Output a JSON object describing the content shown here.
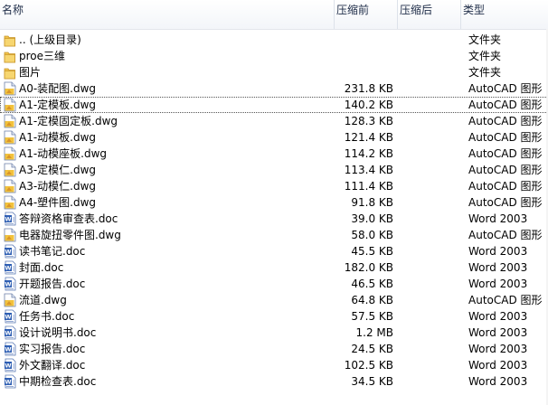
{
  "columns": {
    "name": "名称",
    "size_before": "压缩前",
    "size_after": "压缩后",
    "type": "类型"
  },
  "files": [
    {
      "name": ".. (上级目录)",
      "size": "",
      "type": "文件夹",
      "icon": "folder-icon"
    },
    {
      "name": "proe三维",
      "size": "",
      "type": "文件夹",
      "icon": "folder-icon"
    },
    {
      "name": "图片",
      "size": "",
      "type": "文件夹",
      "icon": "folder-icon"
    },
    {
      "name": "A0-装配图.dwg",
      "size": "231.8 KB",
      "type": "AutoCAD 图形",
      "icon": "dwg-file-icon"
    },
    {
      "name": "A1-定模板.dwg",
      "size": "140.2 KB",
      "type": "AutoCAD 图形",
      "icon": "dwg-file-icon",
      "focused": true
    },
    {
      "name": "A1-定模固定板.dwg",
      "size": "128.3 KB",
      "type": "AutoCAD 图形",
      "icon": "dwg-file-icon"
    },
    {
      "name": "A1-动模板.dwg",
      "size": "121.4 KB",
      "type": "AutoCAD 图形",
      "icon": "dwg-file-icon"
    },
    {
      "name": "A1-动模座板.dwg",
      "size": "114.2 KB",
      "type": "AutoCAD 图形",
      "icon": "dwg-file-icon"
    },
    {
      "name": "A3-定模仁.dwg",
      "size": "113.4 KB",
      "type": "AutoCAD 图形",
      "icon": "dwg-file-icon"
    },
    {
      "name": "A3-动模仁.dwg",
      "size": "111.4 KB",
      "type": "AutoCAD 图形",
      "icon": "dwg-file-icon"
    },
    {
      "name": "A4-塑件图.dwg",
      "size": "91.8 KB",
      "type": "AutoCAD 图形",
      "icon": "dwg-file-icon"
    },
    {
      "name": "答辩资格审查表.doc",
      "size": "39.0 KB",
      "type": "Word 2003",
      "icon": "word-doc-icon"
    },
    {
      "name": "电器旋扭零件图.dwg",
      "size": "58.0 KB",
      "type": "AutoCAD 图形",
      "icon": "dwg-file-icon"
    },
    {
      "name": "读书笔记.doc",
      "size": "45.5 KB",
      "type": "Word 2003",
      "icon": "word-doc-icon"
    },
    {
      "name": "封面.doc",
      "size": "182.0 KB",
      "type": "Word 2003",
      "icon": "word-doc-icon"
    },
    {
      "name": "开题报告.doc",
      "size": "46.5 KB",
      "type": "Word 2003",
      "icon": "word-doc-icon"
    },
    {
      "name": "流道.dwg",
      "size": "64.8 KB",
      "type": "AutoCAD 图形",
      "icon": "dwg-file-icon"
    },
    {
      "name": "任务书.doc",
      "size": "57.5 KB",
      "type": "Word 2003",
      "icon": "word-doc-icon"
    },
    {
      "name": "设计说明书.doc",
      "size": "1.2 MB",
      "type": "Word 2003",
      "icon": "word-doc-icon"
    },
    {
      "name": "实习报告.doc",
      "size": "24.5 KB",
      "type": "Word 2003",
      "icon": "word-doc-icon"
    },
    {
      "name": "外文翻译.doc",
      "size": "102.5 KB",
      "type": "Word 2003",
      "icon": "word-doc-icon"
    },
    {
      "name": "中期检查表.doc",
      "size": "34.5 KB",
      "type": "Word 2003",
      "icon": "word-doc-icon"
    }
  ]
}
